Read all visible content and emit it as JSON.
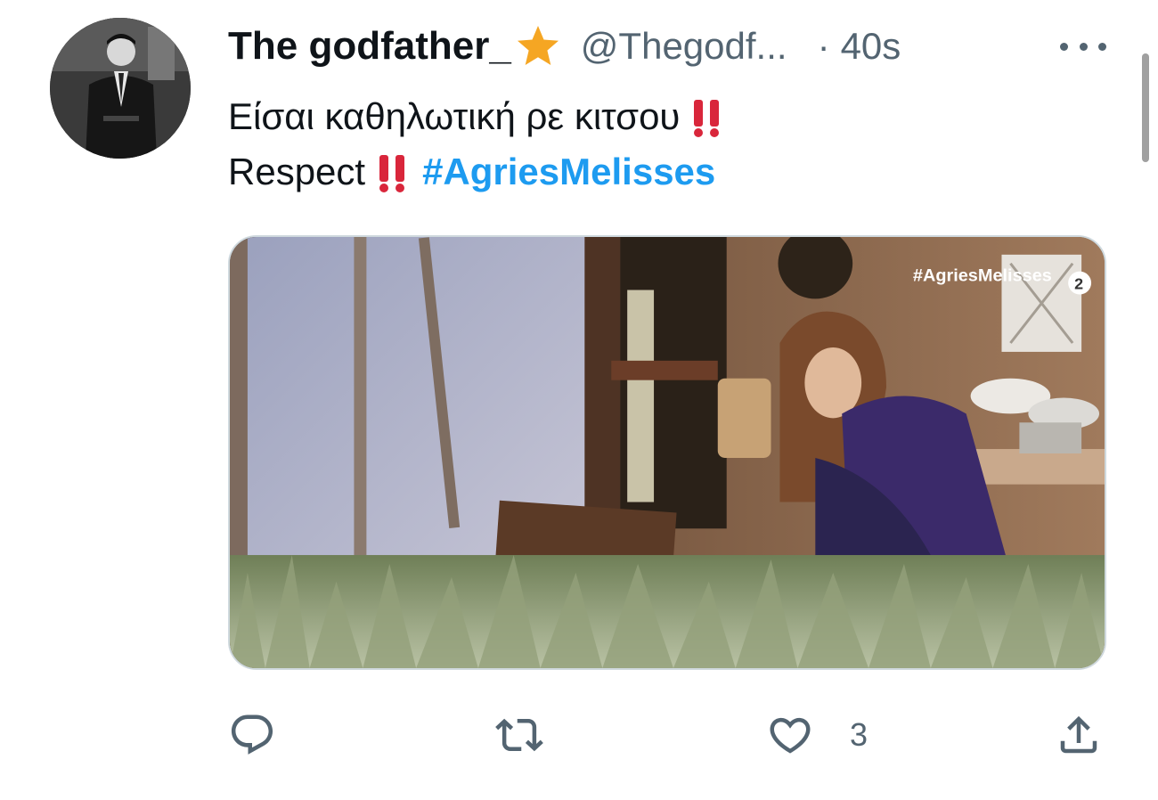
{
  "tweet": {
    "display_name": "The godfather_",
    "handle": "@Thegodf...",
    "separator": "·",
    "time": "40s",
    "text_line1": "Είσαι καθηλωτική ρε κιτσου",
    "text_line2": "Respect",
    "hashtag": "#AgriesMelisses",
    "media_watermark": "#AgriesMelisses",
    "icons": {
      "verified_star": "star-emoji-icon",
      "emphasis": "double-exclamation-icon",
      "more": "more-options-icon",
      "reply": "reply-icon",
      "retweet": "retweet-icon",
      "like": "heart-icon",
      "share": "share-icon"
    }
  },
  "actions": {
    "reply_count": "",
    "retweet_count": "",
    "like_count": "3"
  },
  "colors": {
    "name": "#0f1419",
    "secondary": "#536471",
    "hashtag": "#1d9bf0",
    "star": "#f5a623",
    "emphasis": "#d9263b"
  }
}
